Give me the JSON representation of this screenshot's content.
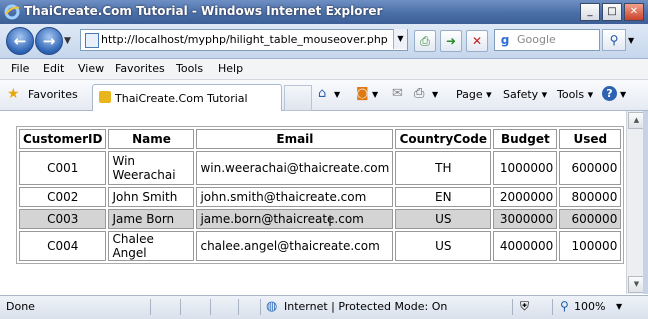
{
  "window": {
    "title": "ThaiCreate.Com Tutorial - Windows Internet Explorer",
    "minimize": "_",
    "maximize": "□",
    "close": "✕"
  },
  "address": {
    "url": "http://localhost/myphp/hilight_table_mouseover.php",
    "back_icon": "back-arrow-icon",
    "forward_icon": "forward-arrow-icon"
  },
  "search": {
    "placeholder": "Google"
  },
  "menu": {
    "items": [
      "File",
      "Edit",
      "View",
      "Favorites",
      "Tools",
      "Help"
    ]
  },
  "favorites": {
    "label": "Favorites",
    "tab_title": "ThaiCreate.Com Tutorial",
    "commands": {
      "page": "Page",
      "safety": "Safety",
      "tools": "Tools"
    }
  },
  "table": {
    "headers": [
      "CustomerID",
      "Name",
      "Email",
      "CountryCode",
      "Budget",
      "Used"
    ],
    "rows": [
      {
        "id": "C001",
        "name": "Win Weerachai",
        "email": "win.weerachai@thaicreate.com",
        "cc": "TH",
        "budget": "1000000",
        "used": "600000",
        "highlight": false
      },
      {
        "id": "C002",
        "name": "John Smith",
        "email": "john.smith@thaicreate.com",
        "cc": "EN",
        "budget": "2000000",
        "used": "800000",
        "highlight": false
      },
      {
        "id": "C003",
        "name": "Jame Born",
        "email": "jame.born@thaicreate.com",
        "cc": "US",
        "budget": "3000000",
        "used": "600000",
        "highlight": true
      },
      {
        "id": "C004",
        "name": "Chalee Angel",
        "email": "chalee.angel@thaicreate.com",
        "cc": "US",
        "budget": "4000000",
        "used": "100000",
        "highlight": false
      }
    ],
    "highlight_color": "#d4d4d4"
  },
  "status": {
    "text": "Done",
    "zone": "Internet | Protected Mode: On",
    "zoom": "100%"
  },
  "colors": {
    "titlebar": "#4a6fa8",
    "chrome": "#dfe9f6"
  }
}
